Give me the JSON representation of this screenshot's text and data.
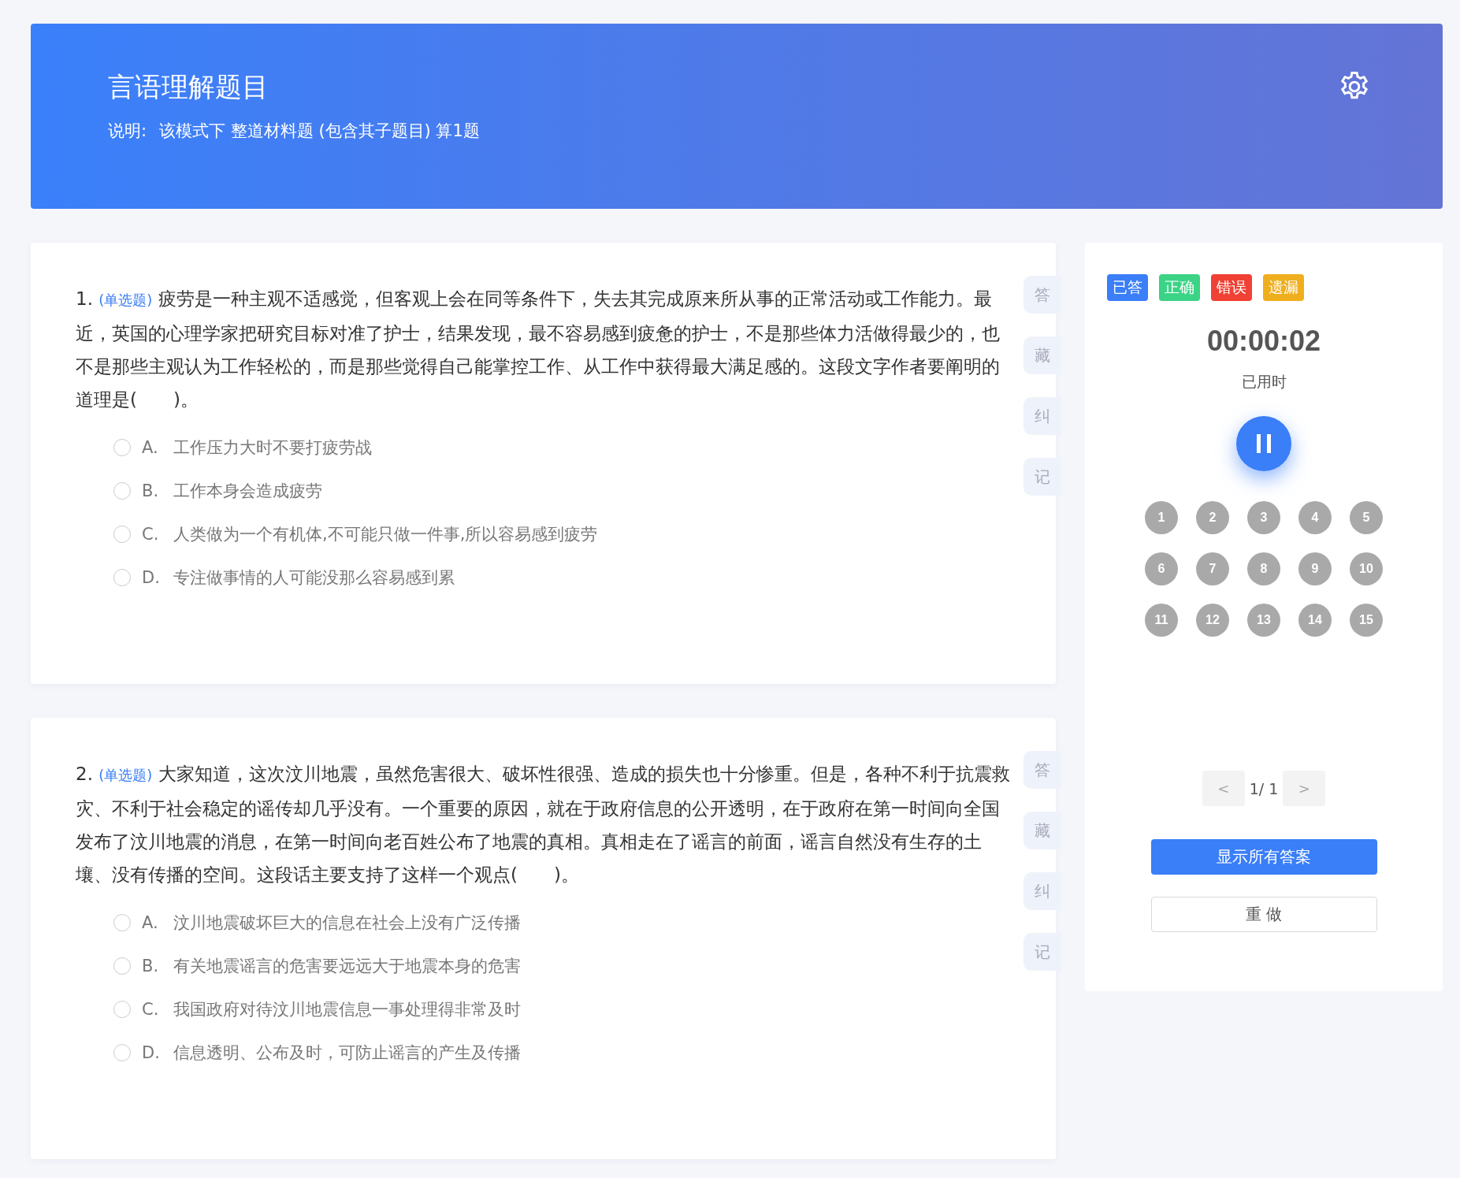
{
  "header": {
    "title": "言语理解题目",
    "note_label": "说明:",
    "note": "该模式下 整道材料题 (包含其子题目) 算1题"
  },
  "questions": [
    {
      "number": "1.",
      "type": "(单选题)",
      "text": "疲劳是一种主观不适感觉，但客观上会在同等条件下，失去其完成原来所从事的正常活动或工作能力。最近，英国的心理学家把研究目标对准了护士，结果发现，最不容易感到疲惫的护士，不是那些体力活做得最少的，也不是那些主观认为工作轻松的，而是那些觉得自己能掌控工作、从工作中获得最大满足感的。这段文字作者要阐明的道理是(　　)。",
      "options": [
        {
          "letter": "A.",
          "text": "工作压力大时不要打疲劳战",
          "selected": false
        },
        {
          "letter": "B.",
          "text": "工作本身会造成疲劳",
          "selected": false
        },
        {
          "letter": "C.",
          "text": "人类做为一个有机体,不可能只做一件事,所以容易感到疲劳",
          "selected": false
        },
        {
          "letter": "D.",
          "text": "专注做事情的人可能没那么容易感到累",
          "selected": false
        }
      ],
      "tools": [
        "答",
        "藏",
        "纠",
        "记"
      ]
    },
    {
      "number": "2.",
      "type": "(单选题)",
      "text": "大家知道，这次汶川地震，虽然危害很大、破坏性很强、造成的损失也十分惨重。但是，各种不利于抗震救灾、不利于社会稳定的谣传却几乎没有。一个重要的原因，就在于政府信息的公开透明，在于政府在第一时间向全国发布了汶川地震的消息，在第一时间向老百姓公布了地震的真相。真相走在了谣言的前面，谣言自然没有生存的土壤、没有传播的空间。这段话主要支持了这样一个观点(　　)。",
      "options": [
        {
          "letter": "A.",
          "text": "汶川地震破坏巨大的信息在社会上没有广泛传播",
          "selected": false
        },
        {
          "letter": "B.",
          "text": "有关地震谣言的危害要远远大于地震本身的危害",
          "selected": false
        },
        {
          "letter": "C.",
          "text": "我国政府对待汶川地震信息一事处理得非常及时",
          "selected": false
        },
        {
          "letter": "D.",
          "text": "信息透明、公布及时，可防止谣言的产生及传播",
          "selected": false
        }
      ],
      "tools": [
        "答",
        "藏",
        "纠",
        "记"
      ]
    }
  ],
  "legend": [
    {
      "label": "已答",
      "color": "#3a7ef8"
    },
    {
      "label": "正确",
      "color": "#3bd385"
    },
    {
      "label": "错误",
      "color": "#f04134"
    },
    {
      "label": "遗漏",
      "color": "#efae1d"
    }
  ],
  "timer": {
    "time": "00:00:02",
    "label": "已用时"
  },
  "question_numbers": [
    "1",
    "2",
    "3",
    "4",
    "5",
    "6",
    "7",
    "8",
    "9",
    "10",
    "11",
    "12",
    "13",
    "14",
    "15"
  ],
  "pager": {
    "prev": "<",
    "page": "1/ 1",
    "next": ">"
  },
  "buttons": [
    {
      "label": "显示所有答案",
      "kind": "primary"
    },
    {
      "label": "重 做",
      "kind": "default"
    }
  ]
}
